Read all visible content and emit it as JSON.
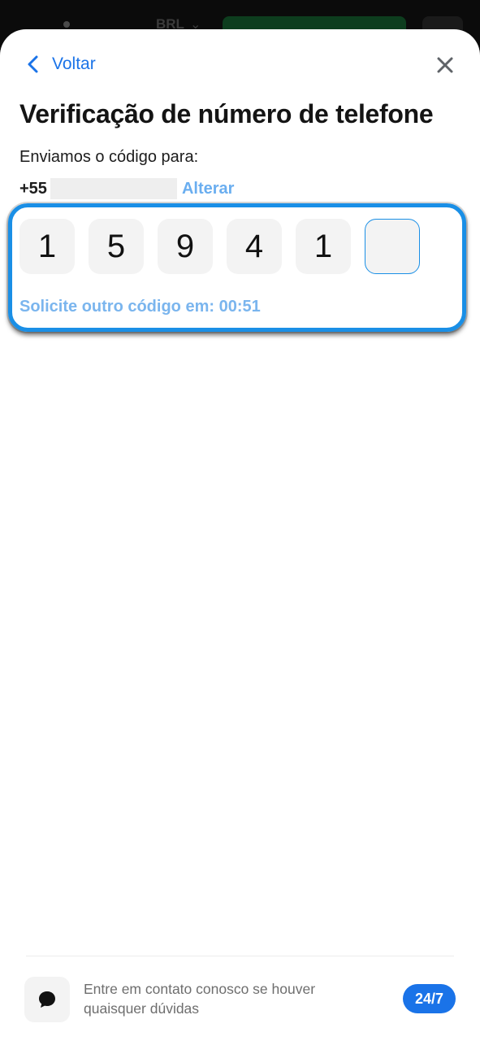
{
  "background": {
    "status_text": "BRL"
  },
  "header": {
    "back_label": "Voltar"
  },
  "title": "Verificação de número de telefone",
  "sent_label": "Enviamos o código para:",
  "phone": {
    "prefix": "+55",
    "change_label": "Alterar"
  },
  "code": {
    "digits": [
      "1",
      "5",
      "9",
      "4",
      "1",
      ""
    ]
  },
  "resend_text": "Solicite outro código em: 00:51",
  "footer": {
    "help_text": "Entre em contato conosco se houver quaisquer dúvidas",
    "badge": "24/7"
  },
  "colors": {
    "accent": "#1a73e8",
    "highlight_frame": "#1a8fe6",
    "link_light": "#6aaef0",
    "input_bg": "#f3f3f3"
  },
  "icons": [
    "chevron-left-icon",
    "close-icon",
    "chat-bubble-icon"
  ]
}
